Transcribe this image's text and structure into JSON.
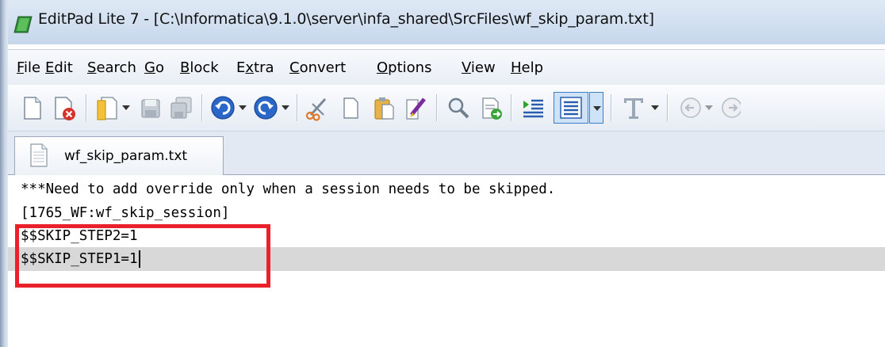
{
  "window": {
    "title": "EditPad Lite 7 - [C:\\Informatica\\9.1.0\\server\\infa_shared\\SrcFiles\\wf_skip_param.txt]",
    "icon": "editpad-app-icon"
  },
  "menu": [
    {
      "key": "F",
      "rest": "ile"
    },
    {
      "key": "E",
      "rest": "dit"
    },
    {
      "key": "S",
      "rest": "earch"
    },
    {
      "key": "G",
      "rest": "o"
    },
    {
      "key": "B",
      "rest": "lock"
    },
    {
      "pre": "E",
      "key": "x",
      "rest": "tra"
    },
    {
      "key": "C",
      "rest": "onvert"
    },
    {
      "key": "O",
      "rest": "ptions"
    },
    {
      "key": "V",
      "rest": "iew"
    },
    {
      "key": "H",
      "rest": "elp"
    }
  ],
  "toolbar": {
    "icons": [
      "new-file-icon",
      "close-file-icon",
      "open-file-icon",
      "save-icon",
      "save-all-icon",
      "undo-icon",
      "redo-icon",
      "cut-icon",
      "copy-icon",
      "paste-icon",
      "clear-icon",
      "find-icon",
      "replace-icon",
      "block-indent-icon",
      "word-wrap-icon",
      "font-icon",
      "back-icon",
      "forward-icon"
    ]
  },
  "tabs": [
    {
      "label": "wf_skip_param.txt",
      "icon": "text-file-icon"
    }
  ],
  "editor": {
    "lines": [
      "***Need to add override only when a session needs to be skipped.",
      "[1765_WF:wf_skip_session]",
      "$$SKIP_STEP2=1",
      "$$SKIP_STEP1=1"
    ],
    "current_line": 4
  },
  "annotation": {
    "color": "#e8212b"
  }
}
